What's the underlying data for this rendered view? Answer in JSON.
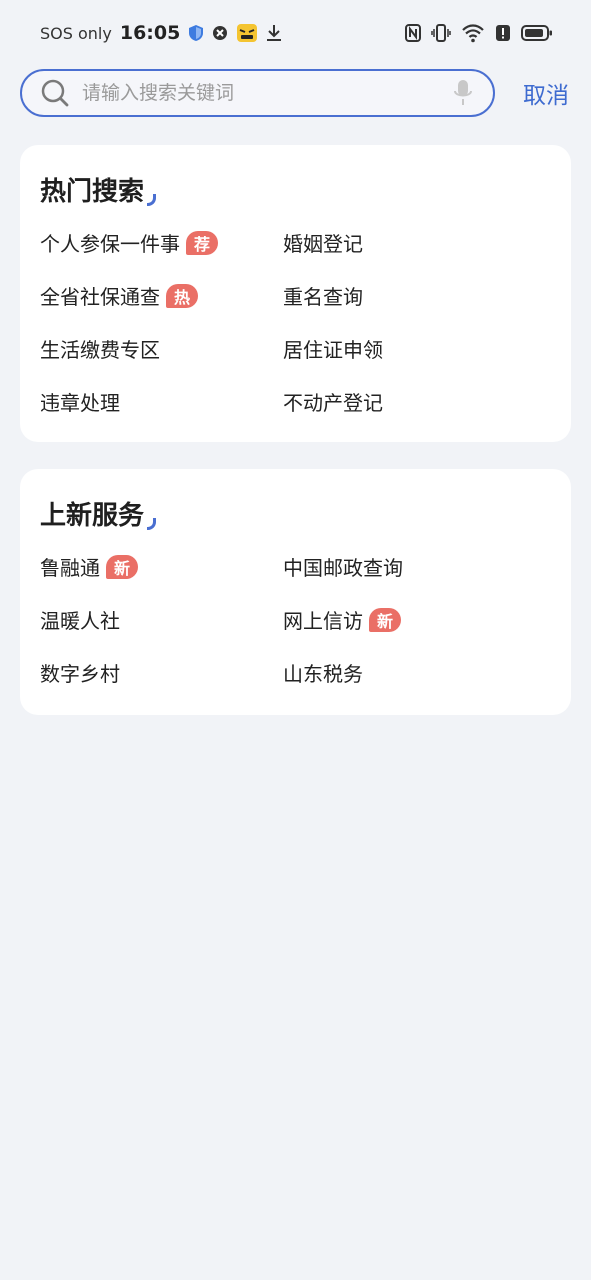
{
  "status_bar": {
    "carrier": "SOS only",
    "time": "16:05",
    "icons": [
      "shield-icon",
      "close-circle-icon",
      "emoji-sticker-icon",
      "download-icon",
      "nfc-icon",
      "vibrate-icon",
      "wifi-icon",
      "alert-icon",
      "battery-icon"
    ]
  },
  "search": {
    "placeholder": "请输入搜索关键词",
    "value": "",
    "cancel_label": "取消"
  },
  "hot_search": {
    "title": "热门搜索",
    "items": [
      {
        "label": "个人参保一件事",
        "badge": "荐"
      },
      {
        "label": "婚姻登记",
        "badge": ""
      },
      {
        "label": "全省社保通查",
        "badge": "热"
      },
      {
        "label": "重名查询",
        "badge": ""
      },
      {
        "label": "生活缴费专区",
        "badge": ""
      },
      {
        "label": "居住证申领",
        "badge": ""
      },
      {
        "label": "违章处理",
        "badge": ""
      },
      {
        "label": "不动产登记",
        "badge": ""
      }
    ]
  },
  "new_services": {
    "title": "上新服务",
    "items": [
      {
        "label": "鲁融通",
        "badge": "新"
      },
      {
        "label": "中国邮政查询",
        "badge": ""
      },
      {
        "label": "温暖人社",
        "badge": ""
      },
      {
        "label": "网上信访",
        "badge": "新"
      },
      {
        "label": "数字乡村",
        "badge": ""
      },
      {
        "label": "山东税务",
        "badge": ""
      }
    ]
  },
  "colors": {
    "accent": "#3e6bd0",
    "badge": "#ea6f66",
    "background": "#f1f3f7",
    "card": "#ffffff"
  }
}
